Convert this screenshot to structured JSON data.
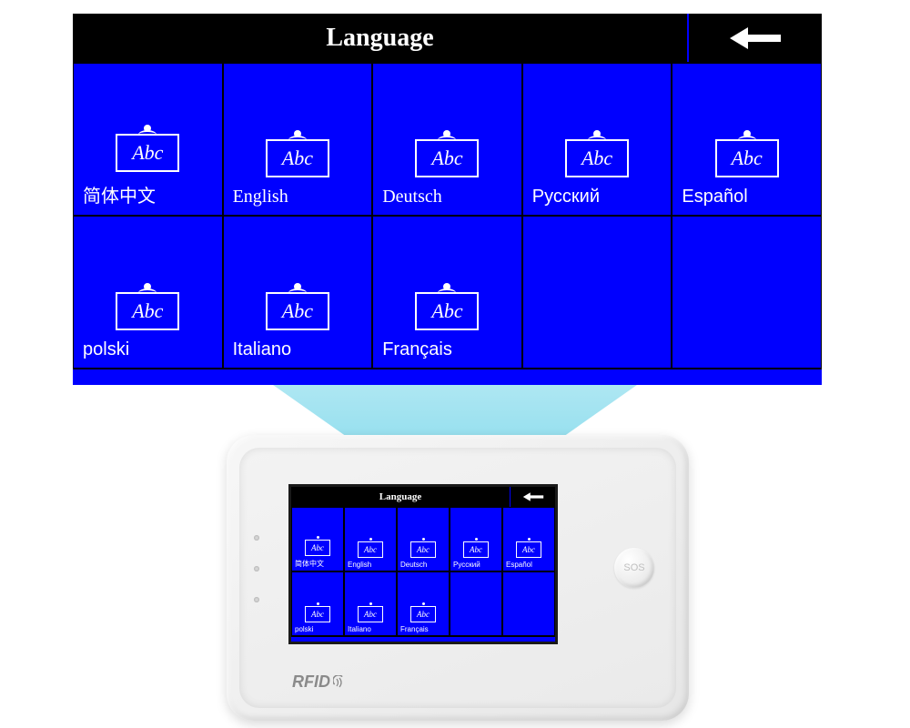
{
  "screen": {
    "title": "Language",
    "icon_text": "Abc",
    "languages": [
      {
        "label": "简体中文"
      },
      {
        "label": "English"
      },
      {
        "label": "Deutsch"
      },
      {
        "label": "Русский"
      },
      {
        "label": "Español"
      },
      {
        "label": "polski"
      },
      {
        "label": "Italiano"
      },
      {
        "label": "Français"
      }
    ]
  },
  "device": {
    "sos_label": "SOS",
    "rfid_label": "RFID"
  }
}
